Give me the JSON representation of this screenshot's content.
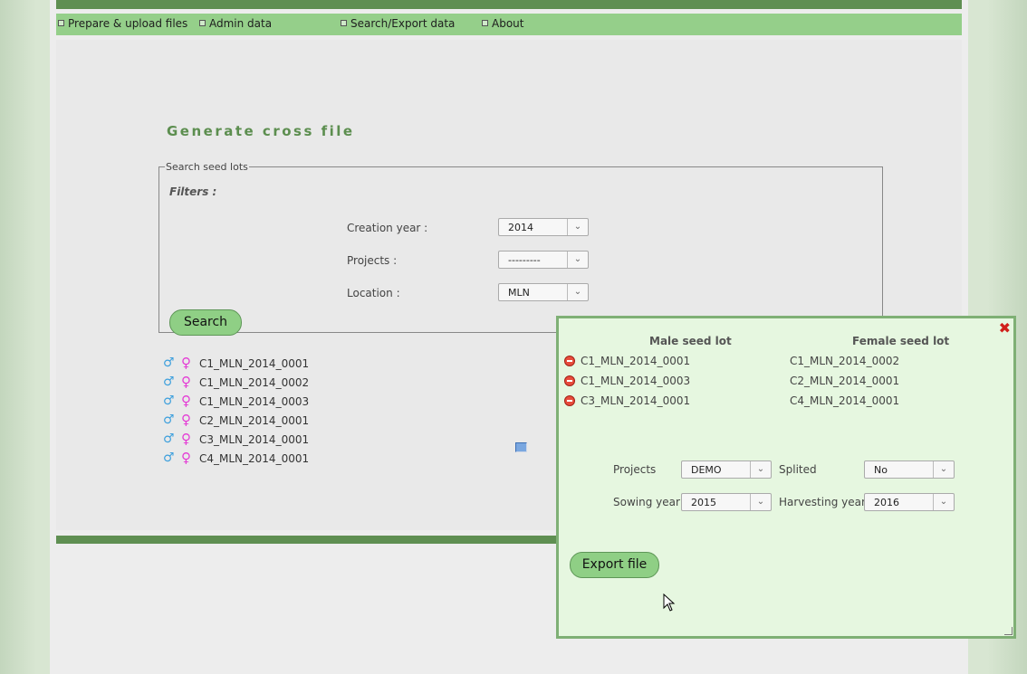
{
  "nav": {
    "items": [
      {
        "label": "Prepare & upload files"
      },
      {
        "label": "Admin data"
      },
      {
        "label": "Search/Export data"
      },
      {
        "label": "About"
      }
    ]
  },
  "page": {
    "title": "Generate cross file"
  },
  "search": {
    "legend": "Search seed lots",
    "filters_label": "Filters :",
    "creation_year": {
      "label": "Creation year :",
      "value": "2014"
    },
    "projects": {
      "label": "Projects :",
      "value": "---------"
    },
    "location": {
      "label": "Location :",
      "value": "MLN"
    },
    "search_button": "Search"
  },
  "seed_lots": [
    "C1_MLN_2014_0001",
    "C1_MLN_2014_0002",
    "C1_MLN_2014_0003",
    "C2_MLN_2014_0001",
    "C3_MLN_2014_0001",
    "C4_MLN_2014_0001"
  ],
  "cross_dialog": {
    "male_header": "Male seed lot",
    "female_header": "Female seed lot",
    "pairs": [
      {
        "male": "C1_MLN_2014_0001",
        "female": "C1_MLN_2014_0002"
      },
      {
        "male": "C1_MLN_2014_0003",
        "female": "C2_MLN_2014_0001"
      },
      {
        "male": "C3_MLN_2014_0001",
        "female": "C4_MLN_2014_0001"
      }
    ],
    "projects": {
      "label": "Projects",
      "value": "DEMO"
    },
    "splited": {
      "label": "Splited",
      "value": "No"
    },
    "sowing_year": {
      "label": "Sowing year",
      "value": "2015"
    },
    "harvesting_year": {
      "label": "Harvesting year",
      "value": "2016"
    },
    "export_button": "Export file"
  },
  "icons": {
    "male": "male-symbol-icon",
    "female": "female-symbol-icon",
    "remove": "remove-circle-icon",
    "close": "close-x-icon"
  },
  "colors": {
    "nav_bg": "#95cf8a",
    "dark_green": "#5f8f52",
    "title_green": "#5c8e4f",
    "button_green": "#8fcf85",
    "dialog_bg": "#e6f7e0",
    "male_blue": "#3fa0dd",
    "female_pink": "#e43bd5",
    "close_red": "#d0201a"
  }
}
